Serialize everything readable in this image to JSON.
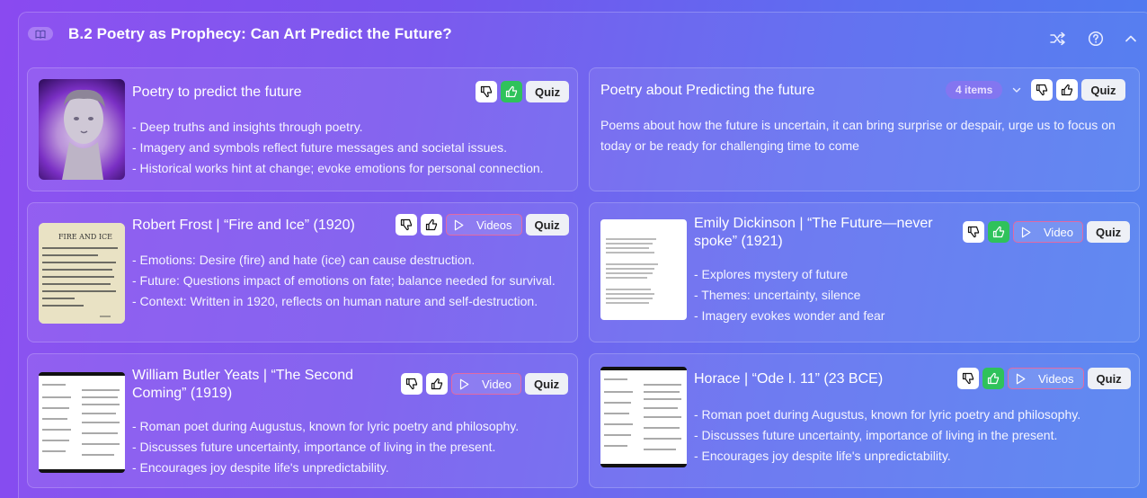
{
  "section": {
    "title": "B.2 Poetry as Prophecy: Can Art Predict the Future?"
  },
  "cards": [
    {
      "title": "Poetry to predict the future",
      "bullets": [
        "- Deep truths and insights through poetry.",
        "- Imagery and symbols reflect future messages and societal issues.",
        "- Historical works hint at change; evoke emotions for personal connection."
      ],
      "quiz_label": "Quiz",
      "liked": true
    },
    {
      "title": "Poetry about Predicting the future",
      "items_count": "4 items",
      "description": "Poems about how the future is uncertain, it can bring surprise or despair, urge us to focus on today or be ready for challenging time to come",
      "quiz_label": "Quiz",
      "liked": false
    },
    {
      "title": "Robert Frost | “Fire and Ice” (1920)",
      "thumb_text": "FIRE AND ICE",
      "bullets": [
        "- Emotions: Desire (fire) and hate (ice) can cause destruction.",
        "- Future: Questions impact of emotions on fate; balance needed for survival.",
        "- Context: Written in 1920, reflects on human nature and self-destruction."
      ],
      "media_label": "Videos",
      "quiz_label": "Quiz",
      "liked": false
    },
    {
      "title": "Emily Dickinson | “The Future—never spoke” (1921)",
      "bullets": [
        "- Explores mystery of future",
        "- Themes: uncertainty, silence",
        "- Imagery evokes wonder and fear"
      ],
      "media_label": "Video",
      "quiz_label": "Quiz",
      "liked": true
    },
    {
      "title": "William Butler Yeats | “The Second Coming” (1919)",
      "bullets": [
        "- Roman poet during Augustus, known for lyric poetry and philosophy.",
        "- Discusses future uncertainty, importance of living in the present.",
        "- Encourages joy despite life's unpredictability."
      ],
      "media_label": "Video",
      "quiz_label": "Quiz",
      "liked": false
    },
    {
      "title": "Horace | “Ode I. 11” (23 BCE)",
      "bullets": [
        "- Roman poet during Augustus, known for lyric poetry and philosophy.",
        "- Discusses future uncertainty, importance of living in the present.",
        "- Encourages joy despite life's unpredictability."
      ],
      "media_label": "Videos",
      "quiz_label": "Quiz",
      "liked": true
    }
  ],
  "colors": {
    "like_active": "#2fc25b",
    "video_border": "#e26aa3"
  }
}
